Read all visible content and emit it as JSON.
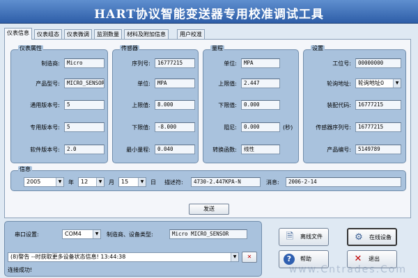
{
  "window": {
    "title": "HART协议智能变送器专用校准调试工具"
  },
  "tabs": [
    "仪表信息",
    "仪表组态",
    "仪表微调",
    "监测数量",
    "材料及附加信息",
    "用户校准"
  ],
  "device_info": {
    "title": "仪表属性",
    "rows": [
      {
        "label": "制造商:",
        "value": "Micro"
      },
      {
        "label": "产品型号:",
        "value": "MICRO_SENSOR"
      },
      {
        "label": "通用版本号:",
        "value": "5"
      },
      {
        "label": "专用版本号:",
        "value": "5"
      },
      {
        "label": "软件版本号:",
        "value": "2.0"
      }
    ]
  },
  "sensor": {
    "title": "传感器",
    "rows": [
      {
        "label": "序列号:",
        "value": "16777215"
      },
      {
        "label": "单位:",
        "value": "MPA"
      },
      {
        "label": "上限值:",
        "value": "8.000"
      },
      {
        "label": "下限值:",
        "value": "-8.000"
      },
      {
        "label": "最小量程:",
        "value": "0.040"
      }
    ]
  },
  "range": {
    "title": "量程",
    "rows": [
      {
        "label": "单位:",
        "value": "MPA"
      },
      {
        "label": "上限值:",
        "value": "2.447"
      },
      {
        "label": "下限值:",
        "value": "0.000"
      },
      {
        "label": "阻尼:",
        "value": "0.000"
      },
      {
        "label": "转换函数:",
        "value": "线性"
      }
    ],
    "damping_unit": "(秒)"
  },
  "settings": {
    "title": "设置",
    "tag_label": "工位号:",
    "tag_value": "00000000",
    "poll_label": "轮询地址:",
    "poll_value": "轮询地址0",
    "assembly_label": "装配代码:",
    "assembly_value": "16777215",
    "sensor_serial_label": "传感器序列号:",
    "sensor_serial_value": "16777215",
    "product_no_label": "产品编号:",
    "product_no_value": "5149789"
  },
  "info": {
    "title": "信息",
    "year": "2005",
    "year_unit": "年",
    "month": "12",
    "month_unit": "月",
    "day": "15",
    "day_unit": "日",
    "desc_label": "描述符:",
    "desc_value": "4730-2.447KPA-N",
    "msg_label": "消息:",
    "msg_value": "2006-2-14"
  },
  "send_button": "发送",
  "bottom": {
    "port_label": "串口设置:",
    "port_value": "COM4",
    "maker_label": "制造商、设备类型:",
    "maker_value": "Micro MICRO_SENSOR",
    "log_value": "(8)警告 --时获取更多设备状态信息! 13:44:38",
    "status": "连接成功!",
    "offline_button": "离线文件",
    "online_button": "在线设备",
    "help_button": "帮助",
    "exit_button": "退出"
  },
  "watermark": "www.Cntrades.Com"
}
